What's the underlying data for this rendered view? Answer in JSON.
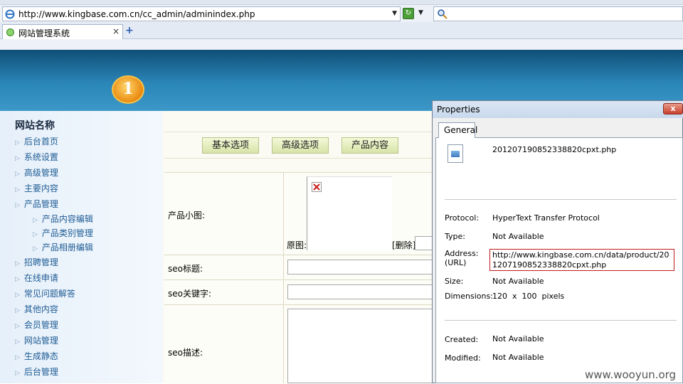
{
  "browser": {
    "address": "http://www.kingbase.com.cn/cc_admin/adminindex.php",
    "tab_title": "网站管理系统",
    "tab_close": "×",
    "new_tab": "+"
  },
  "header": {
    "logo_text": "1"
  },
  "sidebar": {
    "title": "网站名称",
    "items": [
      {
        "label": "后台首页"
      },
      {
        "label": "系统设置"
      },
      {
        "label": "高级管理"
      },
      {
        "label": "主要内容"
      },
      {
        "label": "产品管理"
      },
      {
        "label": "产品内容编辑"
      },
      {
        "label": "产品类别管理"
      },
      {
        "label": "产品相册编辑"
      },
      {
        "label": "招聘管理"
      },
      {
        "label": "在线申请"
      },
      {
        "label": "常见问题解答"
      },
      {
        "label": "其他内容"
      },
      {
        "label": "会员管理"
      },
      {
        "label": "网站管理"
      },
      {
        "label": "生成静态"
      },
      {
        "label": "后台管理"
      }
    ]
  },
  "content": {
    "tabs": [
      "基本选项",
      "高级选项",
      "产品内容"
    ],
    "fields": {
      "small_image": "产品小图:",
      "original": "原图:",
      "delete": "[删除]",
      "seo_title": "seo标题:",
      "seo_keywords": "seo关键字:",
      "seo_desc": "seo描述:"
    }
  },
  "dialog": {
    "title": "Properties",
    "close": "x",
    "tab": "General",
    "filename": "201207190852338820cpxt.php",
    "protocol_label": "Protocol:",
    "protocol": "HyperText Transfer Protocol",
    "type_label": "Type:",
    "type": "Not Available",
    "address_label": "Address:",
    "address_label2": "(URL)",
    "address": "http://www.kingbase.com.cn/data/product/201207190852338820cpxt.php",
    "size_label": "Size:",
    "size": "Not Available",
    "dimensions_label": "Dimensions:",
    "dimensions": "120  x  100  pixels",
    "created_label": "Created:",
    "created": "Not Available",
    "modified_label": "Modified:",
    "modified": "Not Available"
  },
  "watermark": "www.wooyun.org",
  "colors": {
    "banner": "#2b86b8",
    "nav_text": "#1f5c94",
    "url_highlight": "#c4191c"
  }
}
